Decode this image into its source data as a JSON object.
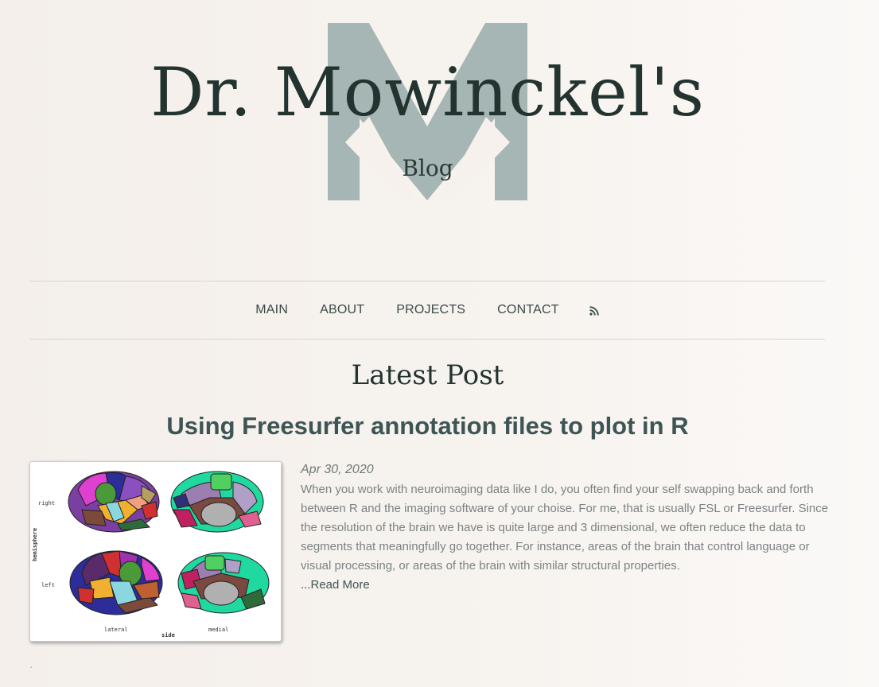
{
  "header": {
    "title": "Dr. Mowinckel's",
    "subtitle": "Blog",
    "logo_color": "#a6b6b5"
  },
  "nav": {
    "items": [
      "MAIN",
      "ABOUT",
      "PROJECTS",
      "CONTACT"
    ],
    "rss_icon": "rss-icon"
  },
  "latest": {
    "heading": "Latest Post"
  },
  "post": {
    "title": "Using Freesurfer annotation files to plot in R",
    "date": "Apr 30, 2020",
    "excerpt": "When you work with neuroimaging data like I do, you often find your self swapping back and forth between R and the imaging software of your choise. For me, that is usually FSL or Freesurfer. Since the resolution of the brain we have is quite large and 3 dimensional, we often reduce the data to segments that meaningfully go together. For instance, areas of the brain that control language or visual processing, or areas of the brain with similar structural properties.",
    "read_more": "...Read More",
    "thumbnail": {
      "row_labels": [
        "right",
        "left"
      ],
      "y_axis_label": "hemisphere",
      "col_labels": [
        "lateral",
        "medial"
      ],
      "x_axis_label": "side"
    }
  },
  "footer_mark": "´"
}
